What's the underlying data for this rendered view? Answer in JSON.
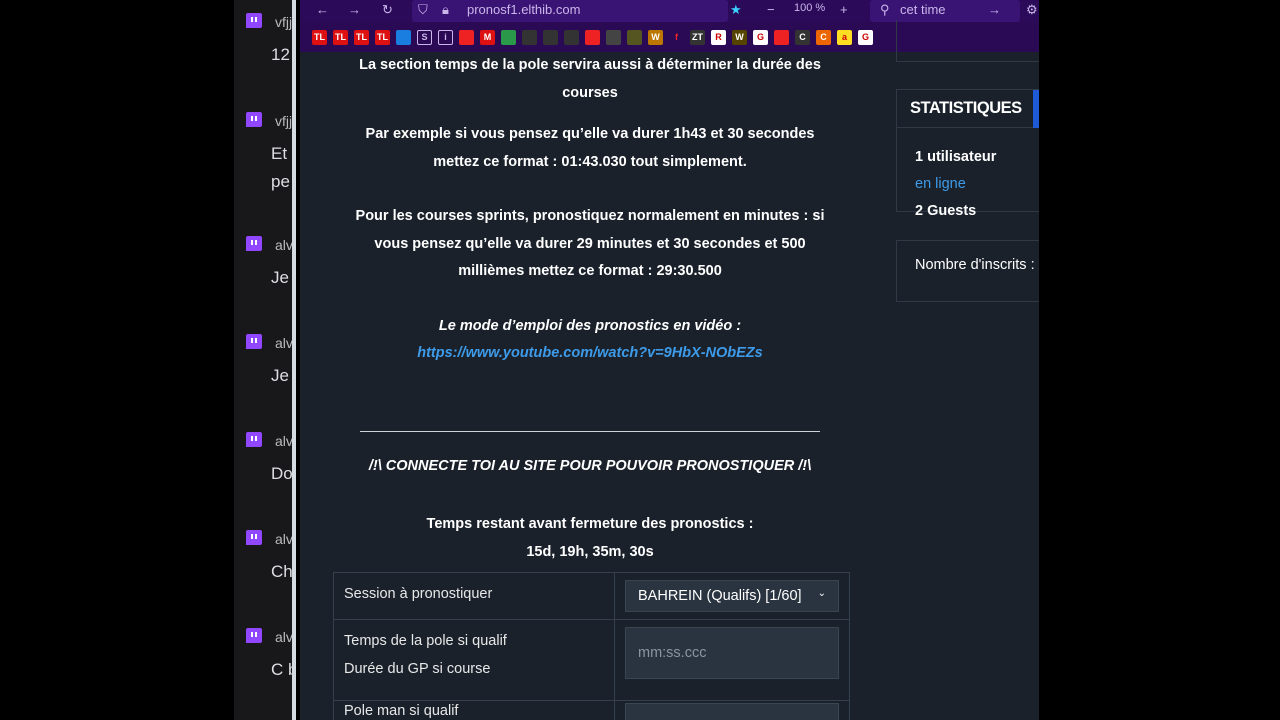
{
  "chat": [
    {
      "user": "vfjj",
      "text": [
        "12"
      ]
    },
    {
      "user": "vfjj",
      "text": [
        "Et",
        "pe"
      ]
    },
    {
      "user": "alv",
      "text": [
        "Je"
      ]
    },
    {
      "user": "alv",
      "text": [
        "Je"
      ]
    },
    {
      "user": "alv",
      "text": [
        "Do"
      ]
    },
    {
      "user": "alv",
      "text": [
        "Ch"
      ]
    },
    {
      "user": "alv",
      "text": [
        "C b"
      ]
    }
  ],
  "browser": {
    "url": "pronosf1.elthib.com",
    "zoom": "100 %",
    "search": "cet time",
    "bookmarks": [
      "TL",
      "TL",
      "TL",
      "TL",
      "",
      "S",
      "i",
      "",
      "M",
      "",
      "",
      "",
      "",
      "",
      "",
      "",
      "W",
      "f",
      "ZT",
      "R",
      "W",
      "G",
      "",
      "C",
      "C",
      "a",
      "G"
    ]
  },
  "main": {
    "p1": "La section temps de la pole servira aussi à déterminer la durée des courses",
    "p2": "Par exemple si vous pensez qu’elle va durer 1h43 et 30 secondes mettez ce format : 01:43.030 tout simplement.",
    "p3": "Pour les courses sprints, pronostiquez normalement en minutes : si vous pensez qu’elle va durer 29 minutes et 30 secondes et 500 millièmes mettez ce format : 29:30.500",
    "video_label": "Le mode d’emploi des pronostics en vidéo :",
    "video_link": "https://www.youtube.com/watch?v=9HbX-NObEZs",
    "connect": "/!\\ CONNECTE TOI AU SITE POUR POUVOIR PRONOSTIQUER /!\\",
    "remaining_label": "Temps restant avant fermeture des pronostics :",
    "remaining": "15d, 19h, 35m, 30s"
  },
  "form": {
    "session_label": "Session à pronostiquer",
    "session_value": "BAHREIN (Qualifs) [1/60]",
    "time_label1": "Temps de la pole si qualif",
    "time_label2": "Durée du GP si course",
    "time_placeholder": "mm:ss.ccc",
    "next_label": "Pole man si qualif"
  },
  "sidebar": {
    "title": "STATISTIQUES",
    "users": "1 utilisateur",
    "online": "en ligne",
    "guests": "2 Guests",
    "registered": "Nombre d'inscrits :"
  }
}
